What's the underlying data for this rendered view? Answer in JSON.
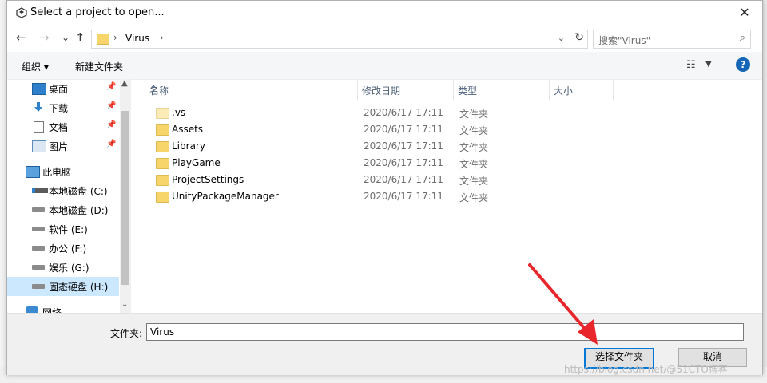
{
  "dialog": {
    "title": "Select a project to open...",
    "close_glyph": "✕"
  },
  "nav": {
    "back_glyph": "←",
    "forward_glyph": "→",
    "recent_glyph": "⌄",
    "up_glyph": "↑",
    "breadcrumb_sep1": "›",
    "breadcrumb": "Virus",
    "breadcrumb_sep2": "›",
    "dropdown_glyph": "⌄",
    "refresh_glyph": "↻",
    "search_placeholder": "搜索\"Virus\"",
    "search_glyph": "⌕"
  },
  "toolbar": {
    "organize_label": "组织 ▾",
    "new_folder_label": "新建文件夹",
    "view_glyph": "☷",
    "view_dropdown_glyph": "▼",
    "help_glyph": "?"
  },
  "sidebar": {
    "pin_glyph": "📌",
    "items": [
      {
        "label": "桌面",
        "icon": "desktop-icon",
        "pinned": true
      },
      {
        "label": "下载",
        "icon": "download-icon",
        "pinned": true
      },
      {
        "label": "文档",
        "icon": "document-icon",
        "pinned": true
      },
      {
        "label": "图片",
        "icon": "picture-icon",
        "pinned": true
      },
      {
        "label": "此电脑",
        "icon": "computer-icon",
        "pinned": false
      },
      {
        "label": "本地磁盘 (C:)",
        "icon": "system-drive-icon",
        "pinned": false
      },
      {
        "label": "本地磁盘 (D:)",
        "icon": "drive-icon",
        "pinned": false
      },
      {
        "label": "软件 (E:)",
        "icon": "drive-icon",
        "pinned": false
      },
      {
        "label": "办公 (F:)",
        "icon": "drive-icon",
        "pinned": false
      },
      {
        "label": "娱乐 (G:)",
        "icon": "drive-icon",
        "pinned": false
      },
      {
        "label": "固态硬盘 (H:)",
        "icon": "drive-icon",
        "pinned": false,
        "selected": true
      },
      {
        "label": "网络",
        "icon": "network-icon",
        "pinned": false
      }
    ],
    "scroll_up_glyph": "▲",
    "scroll_down_glyph": "⌄"
  },
  "columns": {
    "name": "名称",
    "date": "修改日期",
    "type": "类型",
    "size": "大小",
    "sort_glyph": "^"
  },
  "files": [
    {
      "name": ".vs",
      "date": "2020/6/17 17:11",
      "type": "文件夹"
    },
    {
      "name": "Assets",
      "date": "2020/6/17 17:11",
      "type": "文件夹"
    },
    {
      "name": "Library",
      "date": "2020/6/17 17:11",
      "type": "文件夹"
    },
    {
      "name": "PlayGame",
      "date": "2020/6/17 17:11",
      "type": "文件夹"
    },
    {
      "name": "ProjectSettings",
      "date": "2020/6/17 17:11",
      "type": "文件夹"
    },
    {
      "name": "UnityPackageManager",
      "date": "2020/6/17 17:11",
      "type": "文件夹"
    }
  ],
  "footer": {
    "folder_label": "文件夹:",
    "folder_value": "Virus",
    "select_button": "选择文件夹",
    "cancel_button": "取消"
  },
  "watermark": "https://blog.csdn.net/@51CTO博客",
  "colors": {
    "accent": "#0078d7",
    "arrow": "#e8262c",
    "selected_nav": "#cce8ff"
  }
}
